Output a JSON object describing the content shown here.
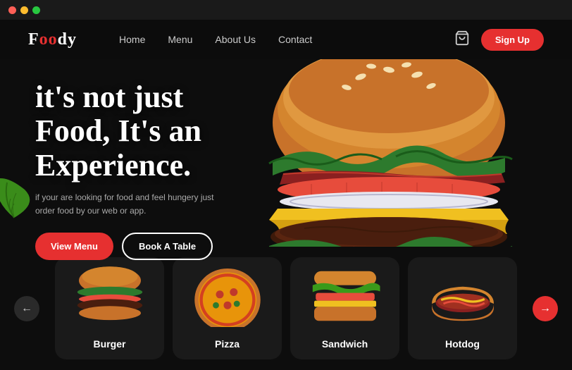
{
  "window": {
    "dots": [
      "red",
      "yellow",
      "green"
    ]
  },
  "navbar": {
    "logo_normal": "F",
    "logo_styled": "oo",
    "logo_end": "dy",
    "logo_full": "Foody",
    "links": [
      {
        "label": "Home",
        "id": "home"
      },
      {
        "label": "Menu",
        "id": "menu"
      },
      {
        "label": "About Us",
        "id": "about"
      },
      {
        "label": "Contact",
        "id": "contact"
      }
    ],
    "signup_label": "Sign Up"
  },
  "hero": {
    "title_line1": "it's not just",
    "title_line2": "Food, It's an",
    "title_line3": "Experience.",
    "subtitle": "if your are looking for food and feel hungery just order food by our web or app.",
    "btn_primary": "View Menu",
    "btn_secondary": "Book A Table"
  },
  "categories": {
    "items": [
      {
        "name": "Burger",
        "id": "burger"
      },
      {
        "name": "Pizza",
        "id": "pizza"
      },
      {
        "name": "Sandwich",
        "id": "sandwich"
      },
      {
        "name": "Hotdog",
        "id": "hotdog"
      }
    ],
    "prev_arrow": "←",
    "next_arrow": "→"
  },
  "colors": {
    "accent": "#e63030",
    "background": "#0d0d0d",
    "card_bg": "#1a1a1a",
    "text_primary": "#ffffff",
    "text_secondary": "#aaaaaa"
  }
}
